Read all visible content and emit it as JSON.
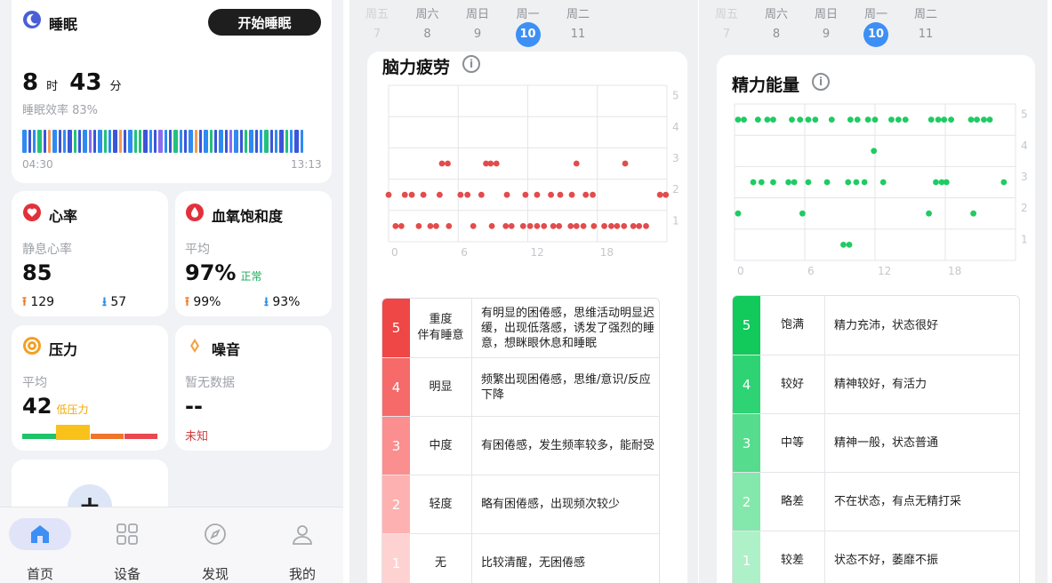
{
  "home": {
    "sleep": {
      "title": "睡眠",
      "button": "开始睡眠",
      "hours": "8",
      "hours_unit": "时",
      "minutes": "43",
      "minutes_unit": "分",
      "efficiency": "睡眠效率 83%",
      "start": "04:30",
      "end": "13:13"
    },
    "heart": {
      "title": "心率",
      "label": "静息心率",
      "value": "85",
      "high": "129",
      "low": "57"
    },
    "spo2": {
      "title": "血氧饱和度",
      "label": "平均",
      "value": "97%",
      "status": "正常",
      "high": "99%",
      "low": "93%"
    },
    "stress": {
      "title": "压力",
      "label": "平均",
      "value": "42",
      "status": "低压力"
    },
    "noise": {
      "title": "噪音",
      "label": "暂无数据",
      "value": "--",
      "status": "未知"
    },
    "tabs": [
      "首页",
      "设备",
      "发现",
      "我的"
    ]
  },
  "week_strip": {
    "days": [
      "周五",
      "周六",
      "周日",
      "周一",
      "周二"
    ],
    "dates": [
      "7",
      "8",
      "9",
      "10",
      "11"
    ],
    "selected_index": 3
  },
  "colors": {
    "accent_blue": "#3d8ff5",
    "fatigue_dot": "#e24c4c",
    "energy_dot": "#1fcb63",
    "fatigue_levels": [
      "#ffd2d2",
      "#fdb1b1",
      "#fb8e8e",
      "#f66a6a",
      "#ef4646"
    ],
    "energy_levels": [
      "#aef0c8",
      "#84e7ac",
      "#55dc8d",
      "#2ed374",
      "#12c95c"
    ]
  },
  "fatigue": {
    "title": "脑力疲劳",
    "info_icon": "info-icon",
    "scale": [
      {
        "level": "5",
        "name": "重度\n伴有睡意",
        "desc": "有明显的困倦感，思维活动明显迟缓，出现低落感，诱发了强烈的睡意，想眯眼休息和睡眠"
      },
      {
        "level": "4",
        "name": "明显",
        "desc": "频繁出现困倦感，思维/意识/反应下降"
      },
      {
        "level": "3",
        "name": "中度",
        "desc": "有困倦感，发生频率较多，能耐受"
      },
      {
        "level": "2",
        "name": "轻度",
        "desc": "略有困倦感，出现频次较少"
      },
      {
        "level": "1",
        "name": "无",
        "desc": "比较清醒，无困倦感"
      }
    ]
  },
  "energy": {
    "title": "精力能量",
    "info_icon": "info-icon",
    "scale": [
      {
        "level": "5",
        "name": "饱满",
        "desc": "精力充沛，状态很好"
      },
      {
        "level": "4",
        "name": "较好",
        "desc": "精神较好，有活力"
      },
      {
        "level": "3",
        "name": "中等",
        "desc": "精神一般，状态普通"
      },
      {
        "level": "2",
        "name": "略差",
        "desc": "不在状态，有点无精打采"
      },
      {
        "level": "1",
        "name": "较差",
        "desc": "状态不好，萎靡不振"
      }
    ]
  },
  "chart_data": [
    {
      "type": "scatter",
      "title": "脑力疲劳",
      "x_ticks": [
        "0",
        "6",
        "12",
        "18"
      ],
      "y_ticks": [
        "1",
        "2",
        "3",
        "4",
        "5"
      ],
      "xlim": [
        0,
        24
      ],
      "ylim": [
        0.5,
        5.5
      ],
      "grid": true,
      "series": [
        {
          "x": [
            4.6,
            5.1,
            8.4,
            8.8,
            9.3,
            16.2,
            20.4
          ],
          "y": [
            3,
            3,
            3,
            3,
            3,
            3,
            3
          ]
        },
        {
          "x": [
            0,
            1.4,
            2.0,
            3.0,
            4.4,
            6.2,
            6.8,
            8.0,
            10.2,
            11.8,
            12.8,
            14.0,
            14.8,
            15.8,
            17.0,
            17.6,
            23.4,
            23.9
          ],
          "y": [
            2,
            2,
            2,
            2,
            2,
            2,
            2,
            2,
            2,
            2,
            2,
            2,
            2,
            2,
            2,
            2,
            2,
            2
          ]
        },
        {
          "x": [
            0.6,
            1.1,
            2.6,
            3.6,
            4.1,
            5.2,
            7.3,
            8.9,
            10.1,
            10.6,
            11.6,
            12.2,
            12.8,
            13.4,
            14.2,
            14.7,
            15.7,
            16.2,
            16.8,
            17.7,
            18.6,
            19.2,
            19.7,
            20.3,
            21.1,
            21.6,
            22.2
          ],
          "y": [
            1,
            1,
            1,
            1,
            1,
            1,
            1,
            1,
            1,
            1,
            1,
            1,
            1,
            1,
            1,
            1,
            1,
            1,
            1,
            1,
            1,
            1,
            1,
            1,
            1,
            1,
            1
          ]
        }
      ]
    },
    {
      "type": "scatter",
      "title": "精力能量",
      "x_ticks": [
        "0",
        "6",
        "12",
        "18"
      ],
      "y_ticks": [
        "1",
        "2",
        "3",
        "4",
        "5"
      ],
      "xlim": [
        0,
        24
      ],
      "ylim": [
        0.5,
        5.5
      ],
      "grid": true,
      "series": [
        {
          "x": [
            0.3,
            0.8,
            2.0,
            2.8,
            3.3,
            4.9,
            5.6,
            6.3,
            6.9,
            8.3,
            9.9,
            10.5,
            11.4,
            12.0,
            13.4,
            14.0,
            14.6,
            16.8,
            17.4,
            17.9,
            18.5,
            20.2,
            20.7,
            21.3,
            21.8
          ],
          "y": [
            5,
            5,
            5,
            5,
            5,
            5,
            5,
            5,
            5,
            5,
            5,
            5,
            5,
            5,
            5,
            5,
            5,
            5,
            5,
            5,
            5,
            5,
            5,
            5,
            5
          ]
        },
        {
          "x": [
            11.9
          ],
          "y": [
            4
          ]
        },
        {
          "x": [
            1.6,
            2.3,
            3.3,
            4.6,
            5.1,
            6.3,
            7.9,
            9.7,
            10.4,
            11.1,
            12.7,
            17.2,
            17.7,
            18.1,
            23.0
          ],
          "y": [
            3,
            3,
            3,
            3,
            3,
            3,
            3,
            3,
            3,
            3,
            3,
            3,
            3,
            3,
            3
          ]
        },
        {
          "x": [
            0.3,
            5.8,
            16.6,
            20.4
          ],
          "y": [
            2,
            2,
            2,
            2
          ]
        },
        {
          "x": [
            9.3,
            9.8
          ],
          "y": [
            1,
            1
          ]
        }
      ]
    }
  ]
}
